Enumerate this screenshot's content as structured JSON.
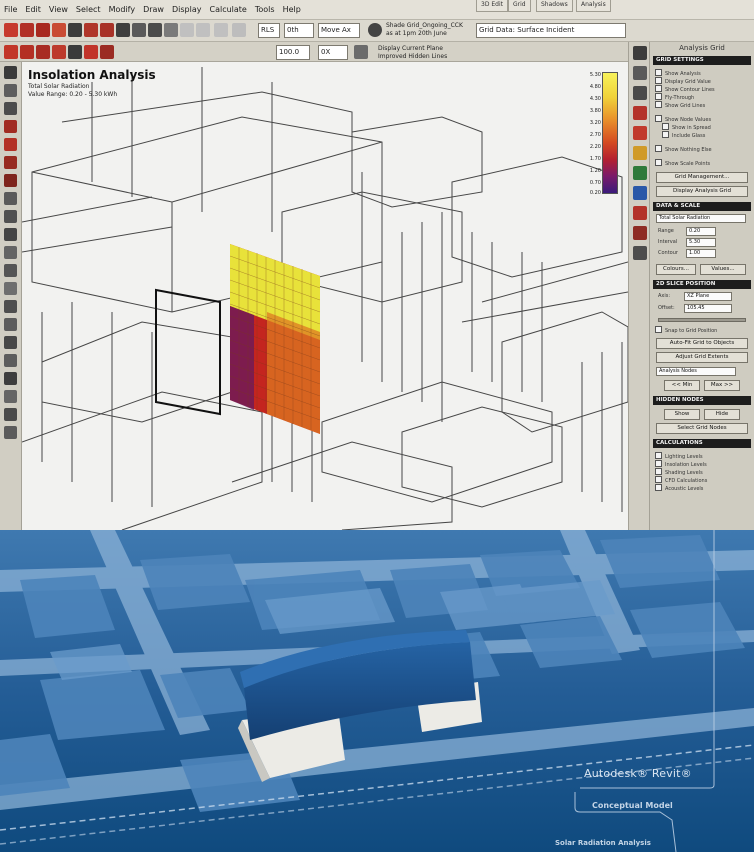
{
  "menubar": {
    "items": [
      "File",
      "Edit",
      "View",
      "Select",
      "Modify",
      "Draw",
      "Display",
      "Calculate",
      "Tools",
      "Help"
    ]
  },
  "toolbar": {
    "combo_1": "RLS",
    "combo_2": "0th",
    "combo_3": "Move Ax",
    "combo_4": "100.0",
    "combo_5": "0X",
    "info_line1": "Shade Grid_Ongoing_CCK",
    "info_line2": "as at 1pm 20th June",
    "option_1": "Display Current Plane",
    "option_2": "Improved Hidden Lines",
    "tabs": [
      "3D Edit",
      "Grid",
      "Shadows",
      "Analysis"
    ],
    "status_field": "Grid Data: Surface Incident"
  },
  "viewport": {
    "title": "Insolation Analysis",
    "line1": "Total Solar Radiation",
    "line2": "Value Range: 0.20 - 5.30 kWh",
    "legend_ticks": [
      "5.30",
      "4.80",
      "4.30",
      "3.80",
      "3.20",
      "2.70",
      "2.20",
      "1.70",
      "1.20",
      "0.70",
      "0.20"
    ],
    "colors": {
      "grid_yellow": "#e8e23a",
      "grid_orange": "#dd7a22",
      "grid_red": "#c4251f",
      "grid_purple": "#6b1a5a"
    }
  },
  "panel": {
    "title": "Analysis Grid",
    "grid_settings": {
      "header": "GRID SETTINGS",
      "checks": [
        "Show Analysis",
        "Display Grid Value",
        "Show Contour Lines",
        "Fly-Through",
        "Show Grid Lines"
      ],
      "subchecks": [
        "Show Node Values",
        "Show in Spread",
        "Include Glass",
        "Show Nothing Else",
        "Show Scale Points"
      ],
      "btn_manage": "Grid Management...",
      "btn_display": "Display Analysis Grid"
    },
    "data_scale": {
      "header": "DATA & SCALE",
      "select": "Total Solar Radiation",
      "labels": [
        "Range",
        "Interval",
        "Contour"
      ],
      "values": [
        "0.20",
        "5.30",
        "1.00"
      ],
      "btn_colours": "Colours...",
      "btn_values": "Values..."
    },
    "slice_position": {
      "header": "2D SLICE POSITION",
      "labels": [
        "Axis:",
        "Offset:"
      ],
      "values": [
        "XZ Plane",
        "105.45"
      ],
      "check": "Snap to Grid Position",
      "btn_auto": "Auto-Fit Grid to Objects",
      "btn_adjust": "Adjust Grid Extents",
      "select_nodes": "Analysis Nodes",
      "btn_min": "<< Min",
      "btn_max": "Max >>"
    },
    "hidden_nodes": {
      "header": "HIDDEN NODES",
      "btn_show": "Show",
      "btn_hide": "Hide",
      "btn_select": "Select Grid Nodes"
    },
    "calculations": {
      "header": "CALCULATIONS",
      "checks": [
        "Lighting Levels",
        "Insolation Levels",
        "Shading Levels",
        "CFD Calculations",
        "Acoustic Levels"
      ]
    }
  },
  "render": {
    "brand": "Autodesk® Revit®",
    "subtitle1": "Conceptual Model",
    "subtitle2": "Solar Radiation Analysis",
    "colors": {
      "background": "#0f4a7e",
      "roads": "#8ab1d6",
      "highlight_building": "#1b4c86",
      "white_blocks": "#ecebe6"
    }
  }
}
